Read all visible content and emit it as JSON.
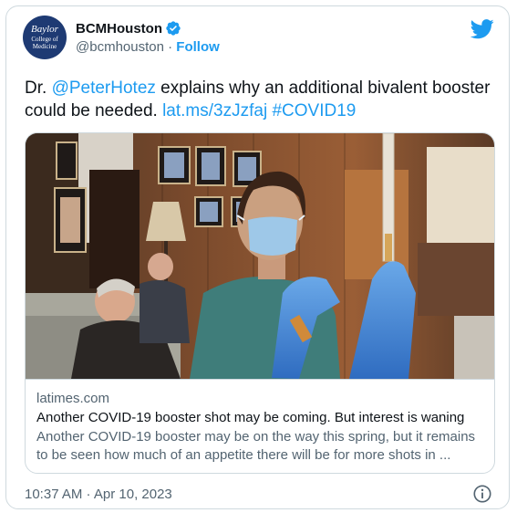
{
  "colors": {
    "accent": "#1d9bf0",
    "text": "#0f1419",
    "secondary": "#536471",
    "border": "#cfd9de"
  },
  "account": {
    "avatar_lines": [
      "Baylor",
      "College of",
      "Medicine"
    ],
    "display_name": "BCMHouston",
    "handle": "@bcmhouston",
    "separator": " · ",
    "follow_label": "Follow",
    "verified": true
  },
  "tweet": {
    "prefix": "Dr. ",
    "mention": "@PeterHotez",
    "body": " explains why an additional bivalent booster could be needed. ",
    "link": "lat.ms/3zJzfaj",
    "space": " ",
    "hashtag": "#COVID19"
  },
  "link_card": {
    "domain": "latimes.com",
    "title": "Another COVID-19 booster shot may be coming. But interest is waning",
    "description": "Another COVID-19 booster may be on the way this spring, but it remains to be seen how much of an appetite there will be for more shots in ..."
  },
  "footer": {
    "timestamp": "10:37 AM · Apr 10, 2023"
  },
  "icons": {
    "logo": "twitter-bird-icon",
    "verified": "verified-badge-icon",
    "info": "info-icon"
  }
}
